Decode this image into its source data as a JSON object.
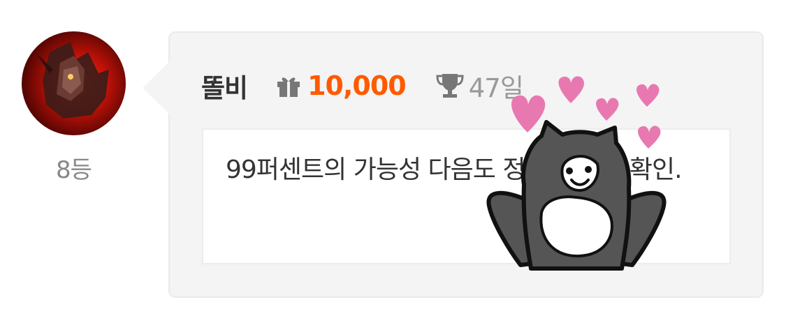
{
  "user": {
    "rank": "8등",
    "nickname": "똘비",
    "gift_amount": "10,000",
    "days": "47일"
  },
  "message": {
    "text": "99퍼센트의 가능성 다음도 정말로 해서 확인."
  },
  "colors": {
    "gift_amount": "#ff5a00",
    "bubble_bg": "#f4f4f4",
    "heart": "#e879b0"
  },
  "icons": {
    "gift": "gift-icon",
    "trophy": "trophy-icon"
  }
}
